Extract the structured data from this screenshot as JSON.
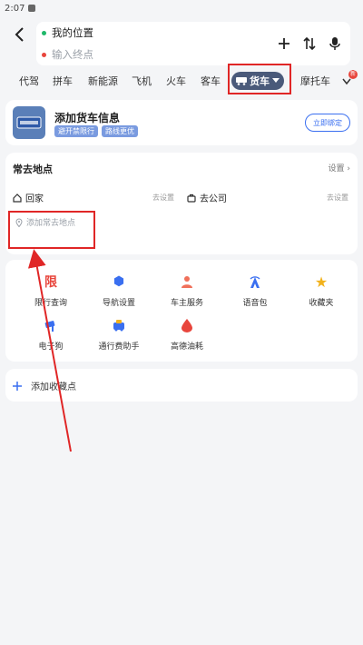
{
  "status_bar": {
    "time": "2:07"
  },
  "route": {
    "start": "我的位置",
    "end_placeholder": "输入终点"
  },
  "modes": {
    "tabs": [
      "代驾",
      "拼车",
      "新能源",
      "飞机",
      "火车",
      "客车"
    ],
    "selected": "货车",
    "after": "摩托车",
    "badge": "新"
  },
  "truck_card": {
    "title": "添加货车信息",
    "tags": [
      "避开禁限行",
      "路线更优"
    ],
    "bind_button": "立即绑定"
  },
  "places": {
    "title": "常去地点",
    "settings": "设置",
    "home": "回家",
    "home_action": "去设置",
    "company": "去公司",
    "company_action": "去设置",
    "add": "添加常去地点"
  },
  "services": [
    {
      "label": "限行查询",
      "icon": "restriction-icon",
      "glyph": "限",
      "color": "#e8453c"
    },
    {
      "label": "导航设置",
      "icon": "settings-icon",
      "glyph": "⬢",
      "color": "#3a6ff0"
    },
    {
      "label": "车主服务",
      "icon": "owner-service-icon",
      "glyph": "●",
      "color": "#f0705a"
    },
    {
      "label": "语音包",
      "icon": "voice-pack-icon",
      "glyph": "▲",
      "color": "#3a6ff0"
    },
    {
      "label": "收藏夹",
      "icon": "favorites-icon",
      "glyph": "★",
      "color": "#f2b21c"
    },
    {
      "label": "电子狗",
      "icon": "speed-camera-icon",
      "glyph": "◐",
      "color": "#3a6ff0"
    },
    {
      "label": "通行费助手",
      "icon": "toll-helper-icon",
      "glyph": "◆",
      "color": "#3a6ff0"
    },
    {
      "label": "高德油耗",
      "icon": "fuel-consumption-icon",
      "glyph": "●",
      "color": "#e8453c"
    }
  ],
  "favorites": {
    "label": "添加收藏点"
  }
}
